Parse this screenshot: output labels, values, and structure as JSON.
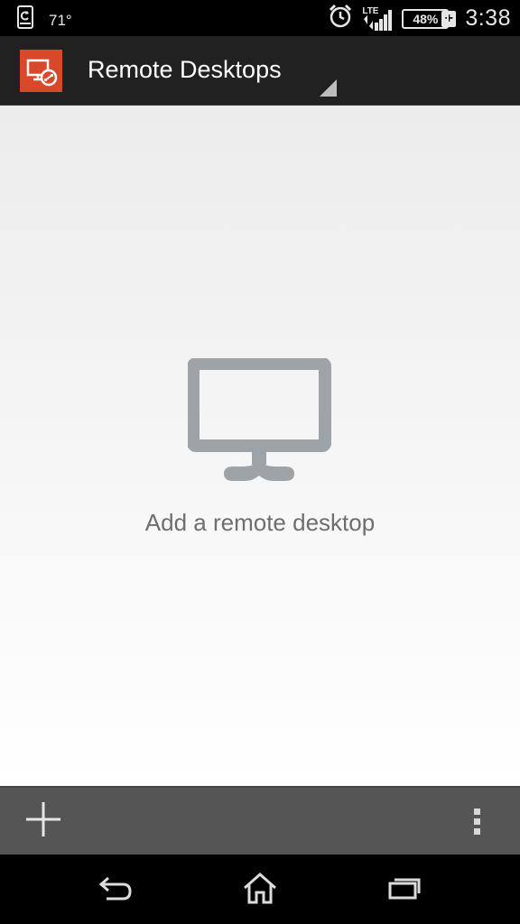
{
  "status_bar": {
    "temperature": "71°",
    "network": "LTE",
    "battery": "48%",
    "charging_symbol": "+",
    "time": "3:38",
    "icons": [
      "phone-sync-icon",
      "alarm-clock-icon",
      "lte-signal-icon",
      "battery-icon"
    ]
  },
  "action_bar": {
    "title": "Remote Desktops",
    "logo_icon": "remote-desktop-logo-icon",
    "accent_color": "#d9482b"
  },
  "empty_state": {
    "icon": "monitor-icon",
    "text": "Add a remote desktop",
    "icon_color": "#9ea3a7"
  },
  "bottom_bar": {
    "add_icon": "plus-icon",
    "menu_icon": "overflow-menu-icon"
  },
  "nav_bar": {
    "buttons": [
      "back-icon",
      "home-icon",
      "recent-apps-icon"
    ]
  }
}
